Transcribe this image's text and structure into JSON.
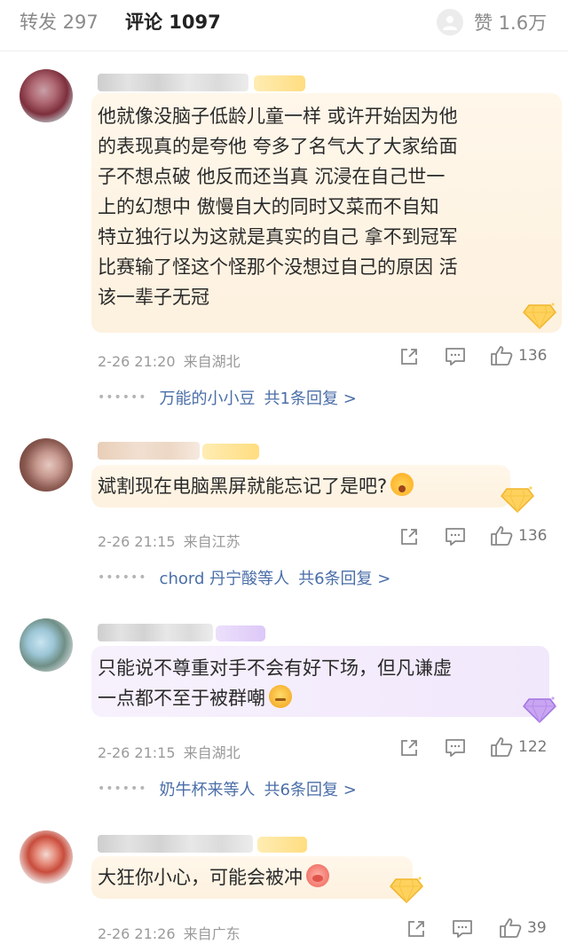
{
  "tabs": {
    "repost_label": "转发 297",
    "comment_label": "评论 1097",
    "like_label": "赞 1.6万"
  },
  "colors": {
    "link": "#4a6ea8",
    "meta": "#9a9a9a",
    "bubble_gold": "#fdf1df",
    "bubble_purple": "#f1e8fb"
  },
  "comments": [
    {
      "lines": [
        "他就像没脑子低龄儿童一样  或许开始因为他",
        "的表现真的是夸他  夸多了名气大了大家给面",
        "子不想点破  他反而还当真  沉浸在自己世一",
        "上的幻想中  傲慢自大的同时又菜而不自知",
        "特立独行以为这就是真实的自己  拿不到冠军",
        "比赛输了怪这个怪那个没想过自己的原因  活",
        "该一辈子无冠"
      ],
      "time": "2-26 21:20",
      "location": "来自湖北",
      "likes": "136",
      "reply_user": "万能的小小豆",
      "reply_etc": "",
      "reply_count": "共1条回复 >",
      "badge": "gold-gem-icon"
    },
    {
      "lines": [
        "斌割现在电脑黑屏就能忘记了是吧?"
      ],
      "time": "2-26 21:15",
      "location": "来自江苏",
      "likes": "136",
      "reply_user": "chord 丹宁酸",
      "reply_etc": "等人",
      "reply_count": "共6条回复 >",
      "badge": "gold-gem-icon"
    },
    {
      "lines": [
        "只能说不尊重对手不会有好下场，但凡谦虚",
        "一点都不至于被群嘲"
      ],
      "time": "2-26 21:15",
      "location": "来自湖北",
      "likes": "122",
      "reply_user": "奶牛杯来",
      "reply_etc": "等人",
      "reply_count": "共6条回复 >",
      "badge": "purple-gem-icon"
    },
    {
      "lines": [
        "大狂你小心，可能会被冲"
      ],
      "time": "2-26 21:26",
      "location": "来自广东",
      "likes": "39",
      "badge": "gold-gem-icon"
    }
  ]
}
